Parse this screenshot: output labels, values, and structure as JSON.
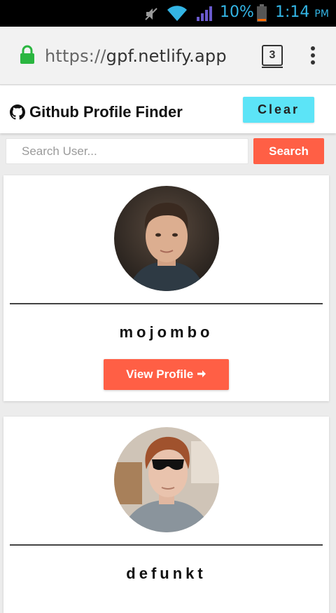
{
  "status_bar": {
    "battery": "10%",
    "time": "1:14",
    "ampm": "PM",
    "icons": [
      "mute-icon",
      "wifi-icon",
      "signal-icon",
      "battery-icon"
    ]
  },
  "browser": {
    "url_protocol": "https://",
    "url_host": "gpf.netlify.app",
    "tab_count": "3",
    "icons": [
      "lock-icon",
      "tab-switcher-icon",
      "overflow-menu-icon"
    ]
  },
  "navbar": {
    "title": "Github Profile Finder",
    "clear_label": "Clear",
    "icon": "github-icon"
  },
  "search": {
    "placeholder": "Search User...",
    "value": "",
    "button_label": "Search"
  },
  "users": [
    {
      "login": "mojombo",
      "button_label": "View Profile"
    },
    {
      "login": "defunkt"
    }
  ],
  "colors": {
    "accent": "#ff5f45",
    "clear_button": "#5ce4f7",
    "status_blue": "#33b5e5",
    "lock_green": "#2ab640"
  }
}
